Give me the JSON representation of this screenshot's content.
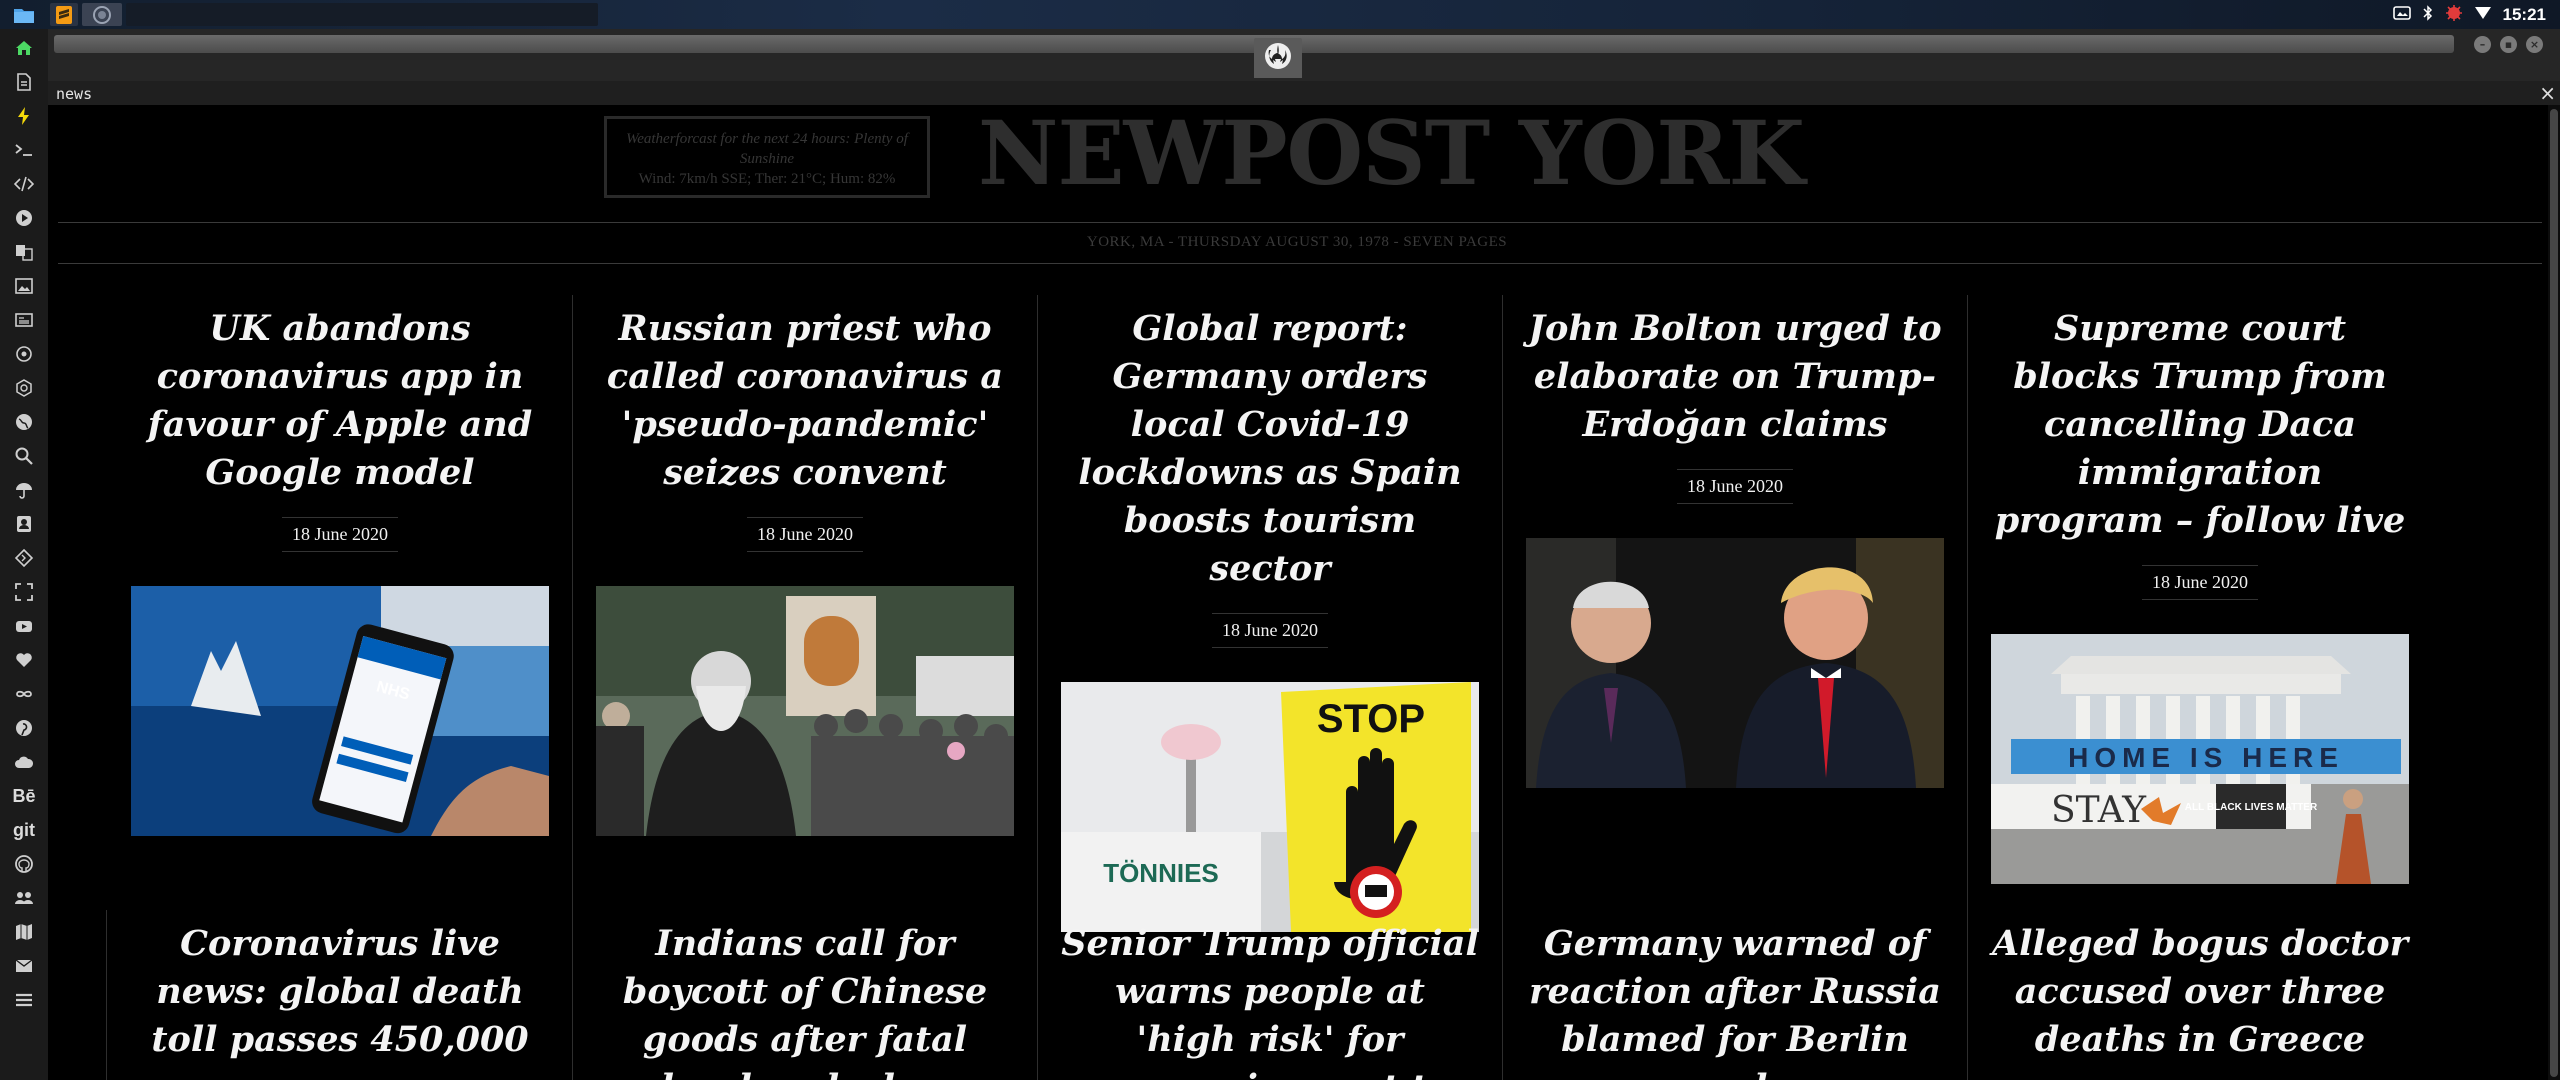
{
  "taskbar": {
    "clock": "15:21"
  },
  "browser": {
    "page_label": "news",
    "close_glyph": "×"
  },
  "newspaper": {
    "weather_forecast": "Weatherforcast for the next 24 hours: Plenty of Sunshine",
    "weather_details": "Wind: 7km/h SSE; Ther: 21°C; Hum: 82%",
    "masthead": "NEWPOST YORK",
    "dateline": "YORK, MA - THURSDAY AUGUST 30, 1978 - SEVEN PAGES",
    "articles": [
      {
        "headline": "UK abandons coronavirus app in favour of Apple and Google model",
        "date": "18 June 2020"
      },
      {
        "headline": "Russian priest who called coronavirus a 'pseudo-pandemic' seizes convent",
        "date": "18 June 2020"
      },
      {
        "headline": "Global report: Germany orders local Covid-19 lockdowns as Spain boosts tourism sector",
        "date": "18 June 2020"
      },
      {
        "headline": "John Bolton urged to elaborate on Trump-Erdoğan claims",
        "date": "18 June 2020"
      },
      {
        "headline": "Supreme court blocks Trump from cancelling Daca immigration program – follow live",
        "date": "18 June 2020"
      }
    ],
    "articles_row2": [
      {
        "headline": "Coronavirus live news: global death toll passes 450,000"
      },
      {
        "headline": "Indians call for boycott of Chinese goods after fatal border clashes"
      },
      {
        "headline": "Senior Trump official warns people at 'high risk' for coronavirus not to"
      },
      {
        "headline": "Germany warned of reaction after Russia blamed for Berlin murder"
      },
      {
        "headline": "Alleged bogus doctor accused over three deaths in Greece"
      }
    ],
    "photo_texts": {
      "nhs": "NHS",
      "stop": "STOP",
      "tonnies": "TÖNNIES",
      "banner": "HOME IS HERE",
      "stay": "STAY",
      "blm": "ALL BLACK LIVES MATTER"
    }
  },
  "dock": {
    "items": [
      "home-icon",
      "document-icon",
      "bolt-icon",
      "terminal-icon",
      "code-icon",
      "play-icon",
      "translate-icon",
      "image-icon",
      "news-icon",
      "atom-icon",
      "blender-icon",
      "globe-icon",
      "search-icon",
      "umbrella-icon",
      "contacts-icon",
      "git-diamond-icon",
      "fullscreen-icon",
      "youtube-icon",
      "heart-icon",
      "infinity-icon",
      "pinterest-icon",
      "cloud-icon",
      "behance-icon",
      "git-icon",
      "github-icon",
      "users-icon",
      "map-icon",
      "mail-icon",
      "list-icon"
    ],
    "behance_label": "Bē",
    "git_label": "git"
  }
}
